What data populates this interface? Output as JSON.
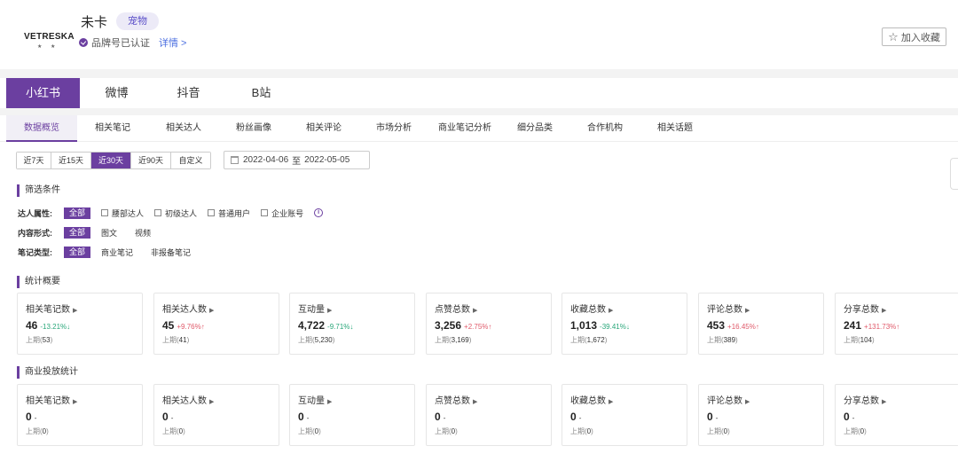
{
  "header": {
    "logo_text": "VETRESKA",
    "logo_sub": "★ ★",
    "brand_name": "未卡",
    "brand_tag": "宠物",
    "verified_text": "品牌号已认证",
    "detail_link": "详情 >",
    "favorite_label": "加入收藏",
    "favorite_icon": "star-icon"
  },
  "platform_tabs": [
    "小红书",
    "微博",
    "抖音",
    "B站"
  ],
  "sub_tabs": [
    "数据概览",
    "相关笔记",
    "相关达人",
    "粉丝画像",
    "相关评论",
    "市场分析",
    "商业笔记分析",
    "细分品类",
    "合作机构",
    "相关话题"
  ],
  "date_range": {
    "options": [
      "近7天",
      "近15天",
      "近30天",
      "近90天",
      "自定义"
    ],
    "active": "近30天",
    "start": "2022-04-06",
    "sep": "至",
    "end": "2022-05-05"
  },
  "filters": {
    "title": "筛选条件",
    "rows": [
      {
        "label": "达人属性:",
        "all": "全部",
        "checkboxes": [
          "腰部达人",
          "初级达人",
          "普通用户",
          "企业账号"
        ],
        "info_icon": "info-icon"
      },
      {
        "label": "内容形式:",
        "all": "全部",
        "options": [
          "图文",
          "视频"
        ]
      },
      {
        "label": "笔记类型:",
        "all": "全部",
        "options": [
          "商业笔记",
          "非报备笔记"
        ]
      }
    ]
  },
  "stats": {
    "title": "统计概要",
    "prev_prefix": "上期(",
    "prev_suffix": ")",
    "cards": [
      {
        "label": "相关笔记数",
        "value": "46",
        "change": "-13.21%↓",
        "dir": "down",
        "prev": "53"
      },
      {
        "label": "相关达人数",
        "value": "45",
        "change": "+9.76%↑",
        "dir": "up",
        "prev": "41"
      },
      {
        "label": "互动量",
        "value": "4,722",
        "change": "-9.71%↓",
        "dir": "down",
        "prev": "5,230"
      },
      {
        "label": "点赞总数",
        "value": "3,256",
        "change": "+2.75%↑",
        "dir": "up",
        "prev": "3,169"
      },
      {
        "label": "收藏总数",
        "value": "1,013",
        "change": "-39.41%↓",
        "dir": "down",
        "prev": "1,672"
      },
      {
        "label": "评论总数",
        "value": "453",
        "change": "+16.45%↑",
        "dir": "up",
        "prev": "389"
      },
      {
        "label": "分享总数",
        "value": "241",
        "change": "+131.73%↑",
        "dir": "up",
        "prev": "104"
      }
    ]
  },
  "commercial": {
    "title": "商业投放统计",
    "cards": [
      {
        "label": "相关笔记数",
        "value": "0",
        "change": "-",
        "dir": "neutral",
        "prev": "0"
      },
      {
        "label": "相关达人数",
        "value": "0",
        "change": "-",
        "dir": "neutral",
        "prev": "0"
      },
      {
        "label": "互动量",
        "value": "0",
        "change": "-",
        "dir": "neutral",
        "prev": "0"
      },
      {
        "label": "点赞总数",
        "value": "0",
        "change": "-",
        "dir": "neutral",
        "prev": "0"
      },
      {
        "label": "收藏总数",
        "value": "0",
        "change": "-",
        "dir": "neutral",
        "prev": "0"
      },
      {
        "label": "评论总数",
        "value": "0",
        "change": "-",
        "dir": "neutral",
        "prev": "0"
      },
      {
        "label": "分享总数",
        "value": "0",
        "change": "-",
        "dir": "neutral",
        "prev": "0"
      }
    ]
  },
  "colors": {
    "accent": "#6b3fa0",
    "down": "#2aa77a",
    "up": "#e05a6a"
  }
}
